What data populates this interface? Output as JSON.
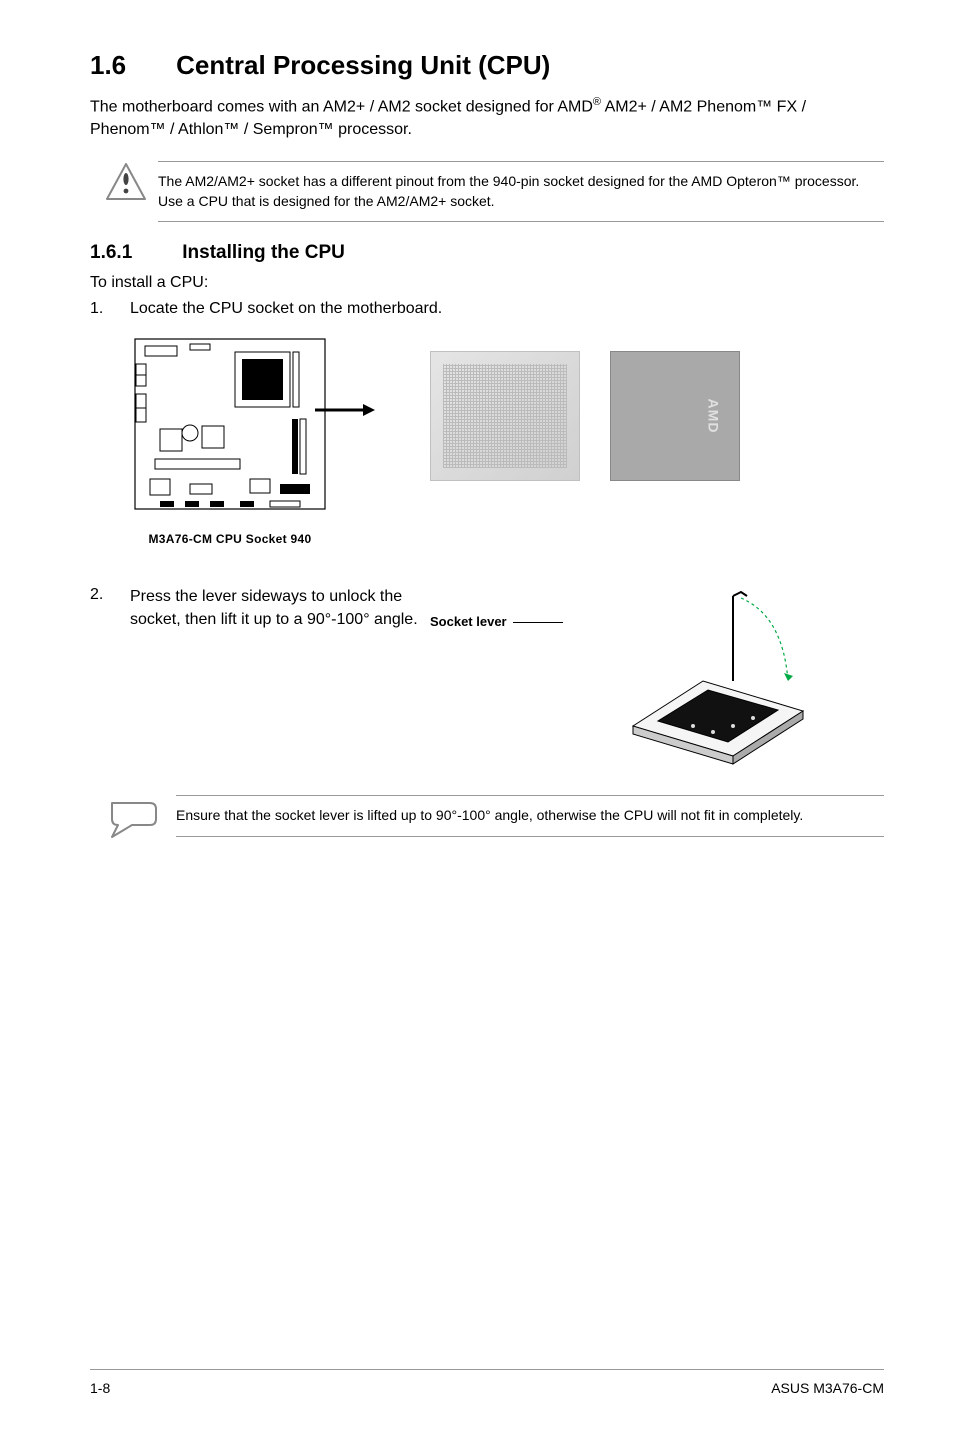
{
  "section": {
    "number": "1.6",
    "title": "Central Processing Unit (CPU)"
  },
  "intro": {
    "prefix": "The motherboard comes with an AM2+ / AM2 socket designed for AMD",
    "reg": "®",
    "suffix": " AM2+ / AM2 Phenom™ FX / Phenom™ / Athlon™ / Sempron™ processor."
  },
  "warning_note": "The AM2/AM2+ socket has a different pinout from the 940-pin socket designed for the AMD Opteron™ processor. Use a CPU that is designed for the AM2/AM2+ socket.",
  "subsection": {
    "number": "1.6.1",
    "title": "Installing the CPU"
  },
  "install_intro": "To install a CPU:",
  "steps": {
    "s1_num": "1.",
    "s1_text": "Locate the CPU socket on the motherboard.",
    "s2_num": "2.",
    "s2_text": "Press the lever sideways to unlock the socket, then lift it up to a 90°-100° angle."
  },
  "mobo_caption": "M3A76-CM CPU Socket 940",
  "amd_label": "AMD",
  "socket_lever_label": "Socket lever",
  "info_note": "Ensure that the socket lever is lifted up to 90°-100° angle, otherwise the CPU will not fit in completely.",
  "footer": {
    "page": "1-8",
    "product": "ASUS M3A76-CM"
  }
}
